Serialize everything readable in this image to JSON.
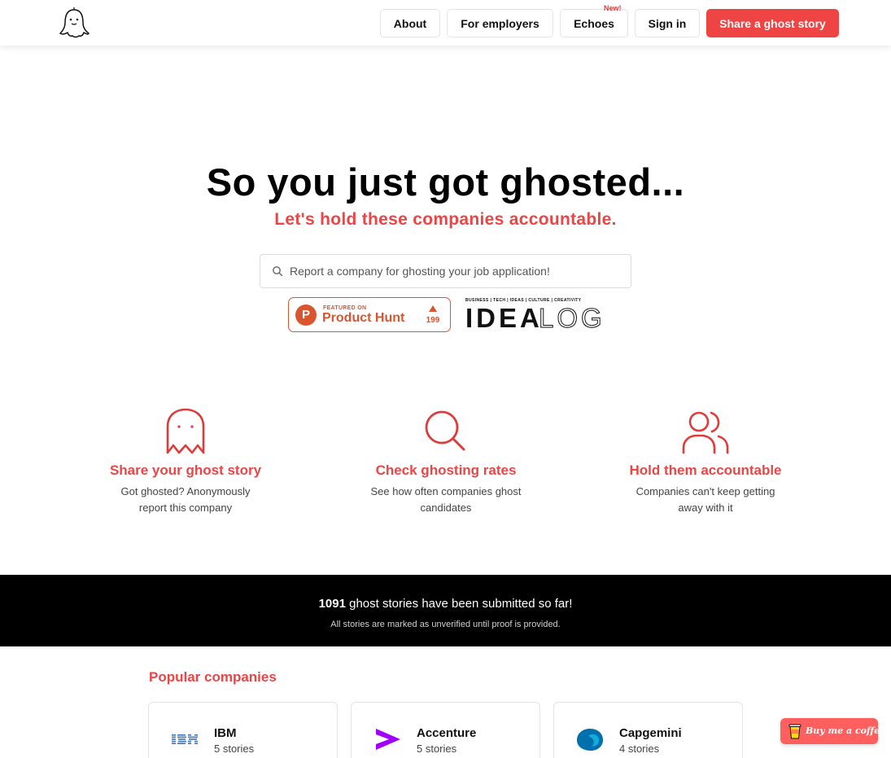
{
  "header": {
    "nav": {
      "about": "About",
      "employers": "For employers",
      "echoes": "Echoes",
      "echoes_badge": "New!",
      "signin": "Sign in",
      "share": "Share a ghost story"
    }
  },
  "hero": {
    "title": "So you just got ghosted...",
    "subtitle": "Let's hold these companies accountable.",
    "search_placeholder": "Report a company for ghosting your job application!"
  },
  "badges": {
    "product_hunt": {
      "featured": "FEATURED ON",
      "name": "Product Hunt",
      "count": "199"
    },
    "idealog": {
      "tagline": "BUSINESS | TECH | IDEAS | CULTURE | CREATIVITY",
      "idea": "IDEA",
      "log": "LOG"
    }
  },
  "features": [
    {
      "icon": "ghost-icon",
      "title": "Share your ghost story",
      "desc": "Got ghosted? Anonymously report this company"
    },
    {
      "icon": "magnifier-icon",
      "title": "Check ghosting rates",
      "desc": "See how often companies ghost candidates"
    },
    {
      "icon": "users-icon",
      "title": "Hold them accountable",
      "desc": "Companies can't keep getting away with it"
    }
  ],
  "stats": {
    "count": "1091",
    "text": "ghost stories have been submitted so far!",
    "note": "All stories are marked as unverified until proof is provided."
  },
  "popular": {
    "title": "Popular companies",
    "companies": [
      {
        "name": "IBM",
        "stories": "5 stories",
        "logo": "ibm-logo"
      },
      {
        "name": "Accenture",
        "stories": "5 stories",
        "logo": "accenture-logo"
      },
      {
        "name": "Capgemini",
        "stories": "4 stories",
        "logo": "capgemini-logo"
      }
    ]
  },
  "coffee": {
    "label": "Buy me a coffee"
  },
  "colors": {
    "accent": "#ee4444",
    "producthunt": "#da552f",
    "band": "#000000"
  }
}
